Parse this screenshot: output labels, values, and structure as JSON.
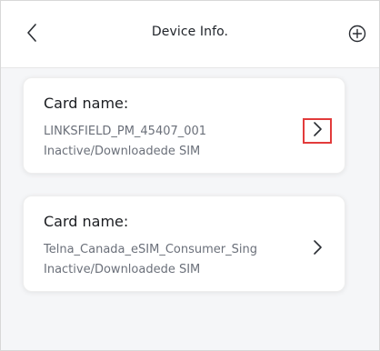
{
  "header": {
    "title": "Device Info.",
    "back_icon": "chevron-left-icon",
    "add_icon": "plus-circle-icon"
  },
  "cards": [
    {
      "label": "Card name:",
      "name": "LINKSFIELD_PM_45407_001",
      "status": "Inactive/Downloadede SIM",
      "action_icon": "chevron-right-icon",
      "highlighted": true
    },
    {
      "label": "Card name:",
      "name": "Telna_Canada_eSIM_Consumer_Sing",
      "status": "Inactive/Downloadede SIM",
      "action_icon": "chevron-right-icon",
      "highlighted": false
    }
  ],
  "colors": {
    "highlight_border": "#e23b3b",
    "background": "#f5f6f8",
    "card_bg": "#ffffff"
  }
}
